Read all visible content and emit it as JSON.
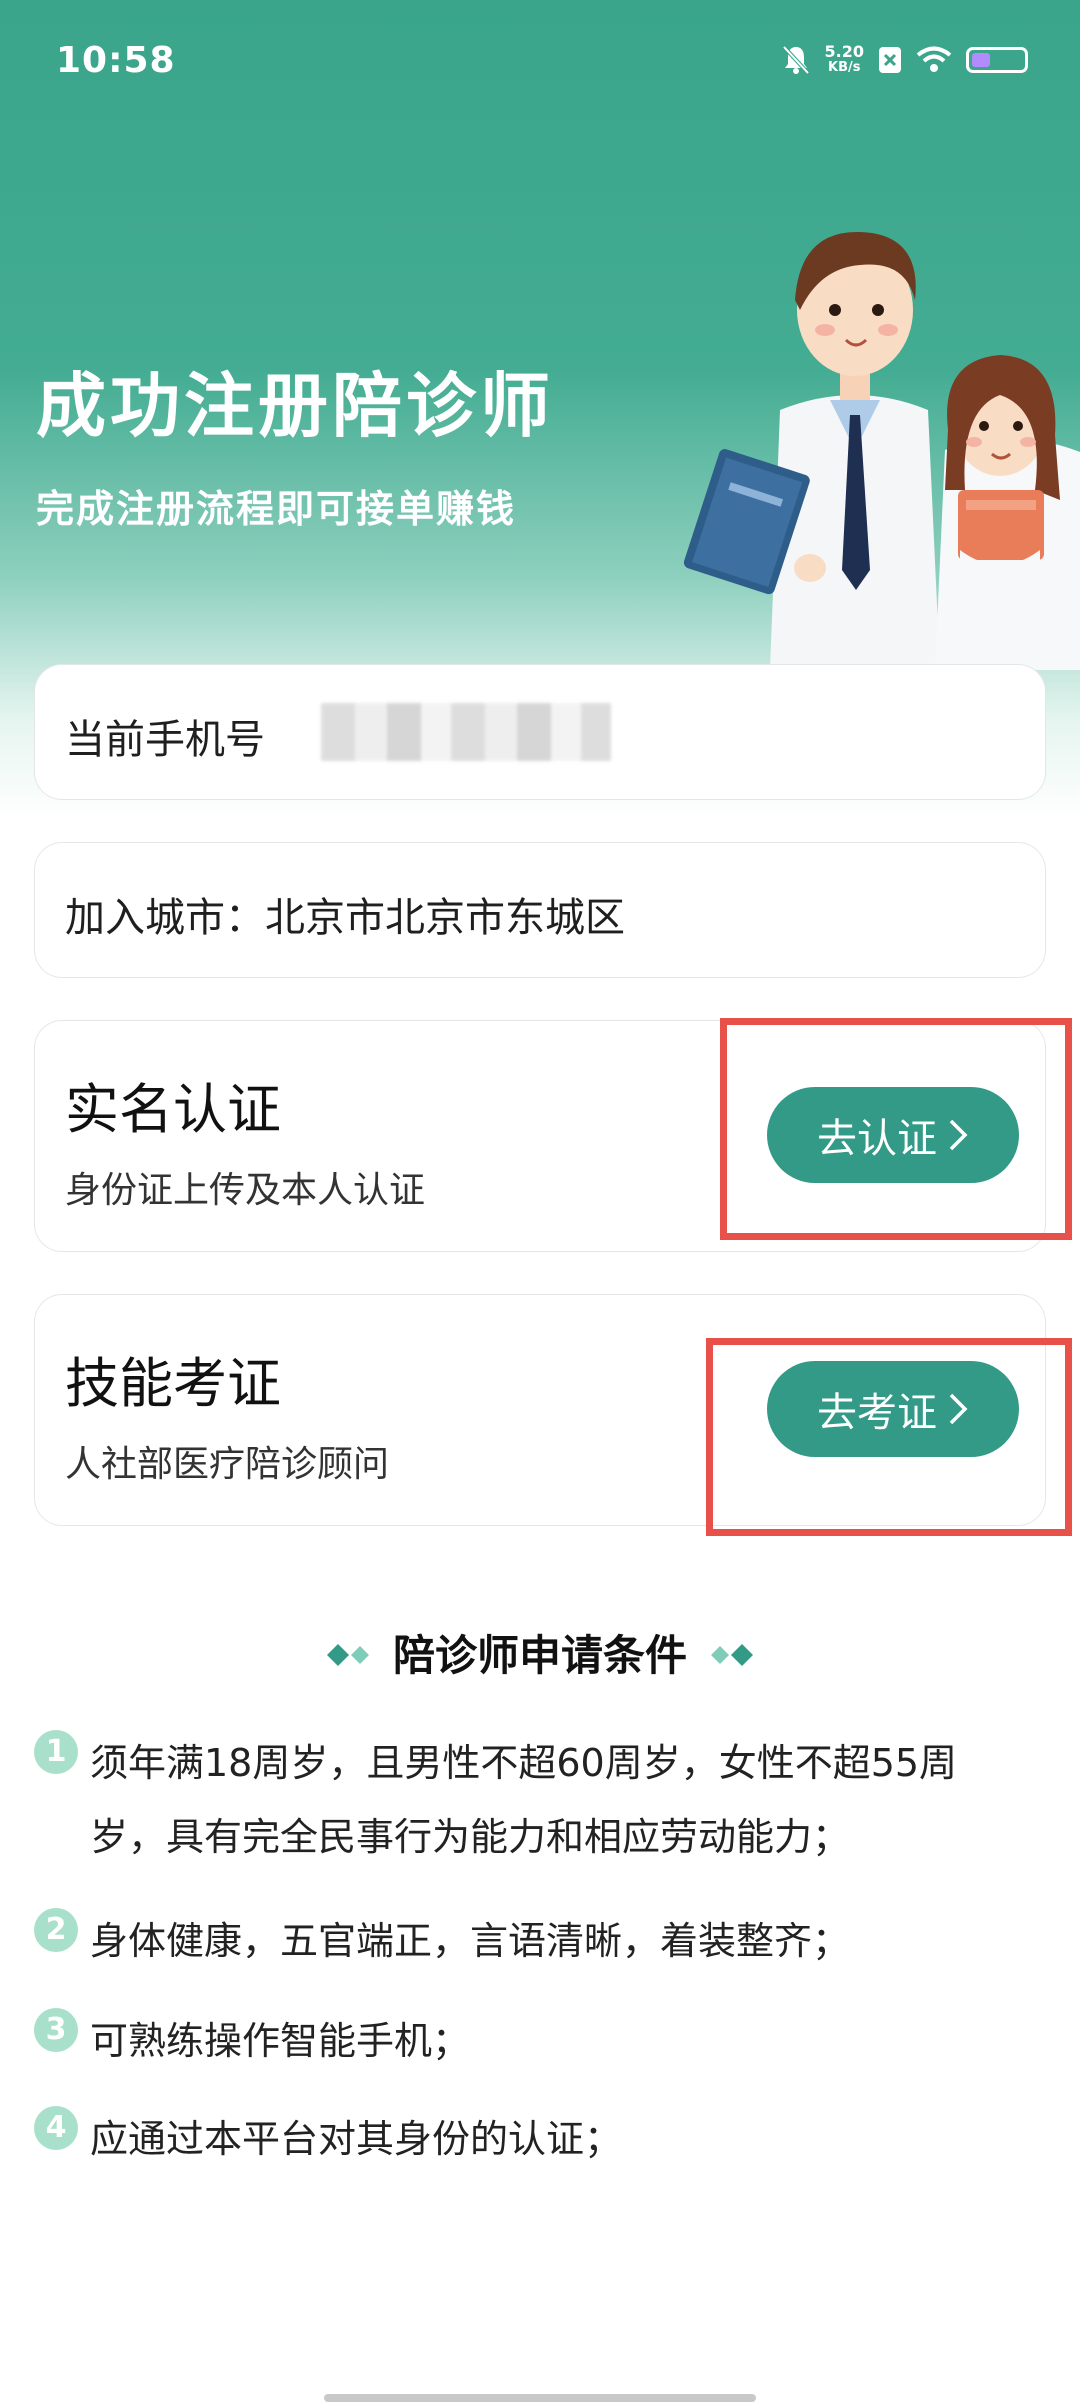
{
  "status_bar": {
    "time": "10:58",
    "net_speed": "5.20",
    "net_unit": "KB/s"
  },
  "hero": {
    "title": "成功注册陪诊师",
    "subtitle": "完成注册流程即可接单赚钱"
  },
  "phone_card": {
    "label": "当前手机号"
  },
  "city_card": {
    "text": "加入城市：北京市北京市东城区"
  },
  "realname_card": {
    "title": "实名认证",
    "subtitle": "身份证上传及本人认证",
    "button_label": "去认证"
  },
  "skill_card": {
    "title": "技能考证",
    "subtitle": "人社部医疗陪诊顾问",
    "button_label": "去考证"
  },
  "conditions": {
    "title": "陪诊师申请条件",
    "items": [
      {
        "num": "1",
        "line1": "须年满18周岁，且男性不超60周岁，女性不超55周",
        "line2": "岁，具有完全民事行为能力和相应劳动能力；"
      },
      {
        "num": "2",
        "line1": "身体健康，五官端正，言语清晰，着装整齐；"
      },
      {
        "num": "3",
        "line1": "可熟练操作智能手机；"
      },
      {
        "num": "4",
        "line1": "应通过本平台对其身份的认证；"
      }
    ]
  },
  "colors": {
    "brand_green": "#339a87",
    "highlight_red": "#e8514a",
    "number_badge": "#a8e0cc"
  }
}
